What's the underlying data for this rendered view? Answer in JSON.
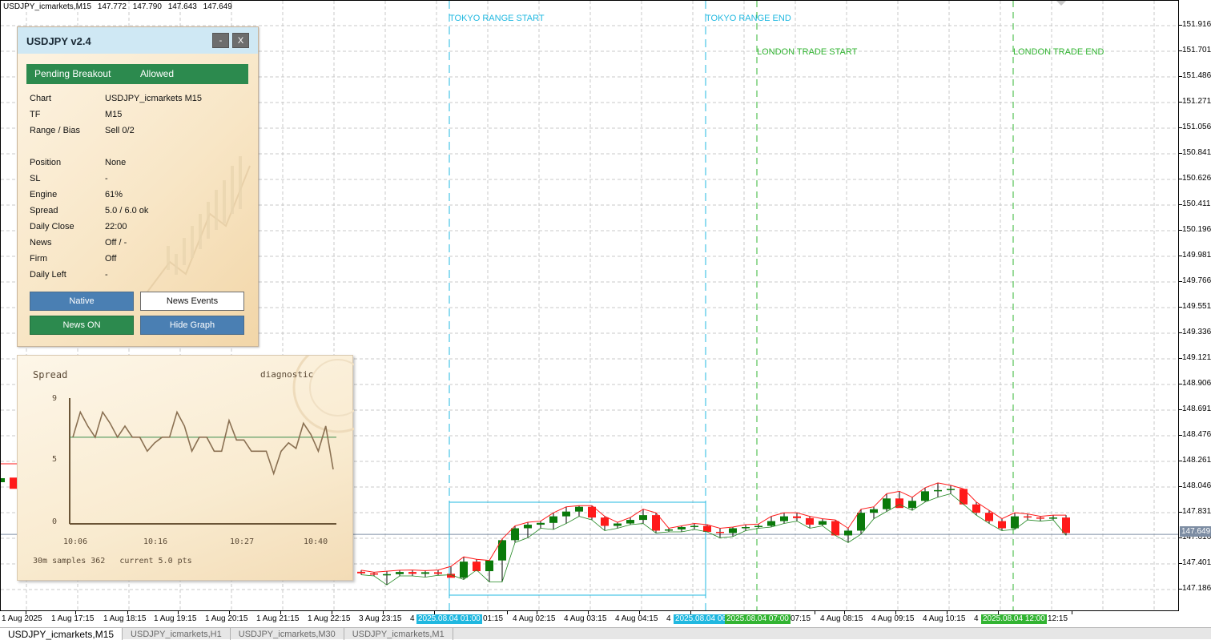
{
  "header": {
    "symbol_tf": "USDJPY_icmarkets,M15",
    "ohlc": [
      "147.772",
      "147.790",
      "147.643",
      "147.649"
    ]
  },
  "session_labels": {
    "tokyo_start": "TOKYO RANGE START",
    "tokyo_end": "TOKYO RANGE END",
    "london_start": "LONDON TRADE START",
    "london_end": "LONDON TRADE END"
  },
  "colors": {
    "tokyo": "#20b8e0",
    "london": "#32b432",
    "bull": "#0a7a0a",
    "bear": "#ff1a1a",
    "grid": "#c8c8c8",
    "current_price": "#7d8da3"
  },
  "price_axis": {
    "ticks": [
      "151.916",
      "151.701",
      "151.486",
      "151.271",
      "151.056",
      "150.841",
      "150.626",
      "150.411",
      "150.196",
      "149.981",
      "149.766",
      "149.551",
      "149.336",
      "149.121",
      "148.906",
      "148.691",
      "148.476",
      "148.261",
      "148.046",
      "147.831",
      "147.616",
      "147.401",
      "147.186"
    ],
    "current": "147.649"
  },
  "time_axis": {
    "ticks": [
      "1 Aug 2025",
      "1 Aug 17:15",
      "1 Aug 18:15",
      "1 Aug 19:15",
      "1 Aug 20:15",
      "1 Aug 21:15",
      "1 Aug 22:15",
      "3 Aug 23:15",
      "4",
      "01:15",
      "4 Aug 02:15",
      "4 Aug 03:15",
      "4 Aug 04:15",
      "4",
      "07:15",
      "4 Aug 08:15",
      "4 Aug 09:15",
      "4 Aug 10:15",
      "4",
      "12:15"
    ],
    "badges": [
      "2025.08.04 01:00",
      "2025.08.04 06:",
      "2025.08.04 07:00",
      "2025.08.04 12:00"
    ]
  },
  "tabs": [
    "USDJPY_icmarkets,M15",
    "USDJPY_icmarkets,H1",
    "USDJPY_icmarkets,M30",
    "USDJPY_icmarkets,M1"
  ],
  "panel": {
    "title": "USDJPY v2.4",
    "minimize": "-",
    "close": "X",
    "mode_label": "Pending Breakout",
    "mode_value": "Allowed",
    "rows": [
      {
        "label": "Chart",
        "value": "USDJPY_icmarkets M15"
      },
      {
        "label": "TF",
        "value": "M15"
      },
      {
        "label": "Range / Bias",
        "value": "Sell 0/2"
      },
      {
        "label": "Position",
        "value": "None"
      },
      {
        "label": "SL",
        "value": "-"
      },
      {
        "label": "Engine",
        "value": "61%"
      },
      {
        "label": "Spread",
        "value": "5.0 / 6.0 ok"
      },
      {
        "label": "Daily Close",
        "value": "22:00"
      },
      {
        "label": "News",
        "value": "Off / -"
      },
      {
        "label": "Firm",
        "value": "Off"
      },
      {
        "label": "Daily Left",
        "value": "-"
      }
    ],
    "buttons": {
      "native": "Native",
      "news_events": "News Events",
      "news_on": "News ON",
      "hide_graph": "Hide Graph"
    }
  },
  "spread_widget": {
    "title": "Spread",
    "tag": "diagnostic",
    "y_ticks": [
      "9",
      "5",
      "0"
    ],
    "x_ticks": [
      "10:06",
      "10:16",
      "10:27",
      "10:40"
    ],
    "footer": "30m samples 362   current 5.0 pts",
    "series": [
      6.2,
      8.0,
      7.0,
      6.2,
      8.0,
      7.2,
      6.2,
      7.0,
      6.2,
      6.2,
      5.2,
      5.8,
      6.2,
      6.2,
      8.0,
      7.0,
      5.2,
      6.2,
      6.2,
      5.2,
      5.2,
      7.4,
      6.0,
      6.0,
      5.2,
      5.2,
      5.2,
      3.6,
      5.2,
      5.8,
      5.4,
      7.2,
      6.4,
      5.2,
      7.0,
      3.9
    ],
    "avg": 6.2,
    "ymax": 9
  },
  "candles": [
    [
      147.335,
      147.348,
      147.31,
      147.322
    ],
    [
      147.322,
      147.331,
      147.3,
      147.311
    ],
    [
      147.311,
      147.34,
      147.225,
      147.315
    ],
    [
      147.315,
      147.348,
      147.3,
      147.333
    ],
    [
      147.333,
      147.35,
      147.3,
      147.318
    ],
    [
      147.318,
      147.345,
      147.29,
      147.331
    ],
    [
      147.331,
      147.35,
      147.305,
      147.318
    ],
    [
      147.318,
      147.38,
      147.31,
      147.285
    ],
    [
      147.285,
      147.46,
      147.27,
      147.42
    ],
    [
      147.42,
      147.44,
      147.35,
      147.34
    ],
    [
      147.34,
      147.43,
      147.25,
      147.43
    ],
    [
      147.43,
      147.61,
      147.25,
      147.6
    ],
    [
      147.6,
      147.72,
      147.58,
      147.7
    ],
    [
      147.7,
      147.75,
      147.62,
      147.73
    ],
    [
      147.73,
      147.76,
      147.7,
      147.745
    ],
    [
      147.745,
      147.83,
      147.69,
      147.8
    ],
    [
      147.8,
      147.88,
      147.74,
      147.84
    ],
    [
      147.84,
      147.89,
      147.8,
      147.88
    ],
    [
      147.88,
      147.89,
      147.77,
      147.79
    ],
    [
      147.79,
      147.8,
      147.68,
      147.72
    ],
    [
      147.72,
      147.75,
      147.7,
      147.74
    ],
    [
      147.74,
      147.79,
      147.73,
      147.77
    ],
    [
      147.77,
      147.86,
      147.74,
      147.81
    ],
    [
      147.81,
      147.83,
      147.66,
      147.68
    ],
    [
      147.68,
      147.7,
      147.67,
      147.69
    ],
    [
      147.69,
      147.72,
      147.67,
      147.71
    ],
    [
      147.71,
      147.74,
      147.69,
      147.72
    ],
    [
      147.72,
      147.73,
      147.67,
      147.67
    ],
    [
      147.67,
      147.7,
      147.62,
      147.66
    ],
    [
      147.66,
      147.71,
      147.63,
      147.7
    ],
    [
      147.7,
      147.73,
      147.68,
      147.71
    ],
    [
      147.71,
      147.735,
      147.7,
      147.72
    ],
    [
      147.72,
      147.8,
      147.71,
      147.76
    ],
    [
      147.76,
      147.83,
      147.74,
      147.8
    ],
    [
      147.8,
      147.83,
      147.76,
      147.785
    ],
    [
      147.785,
      147.8,
      147.7,
      147.73
    ],
    [
      147.73,
      147.78,
      147.72,
      147.76
    ],
    [
      147.76,
      147.77,
      147.64,
      147.64
    ],
    [
      147.64,
      147.7,
      147.58,
      147.68
    ],
    [
      147.68,
      147.86,
      147.65,
      147.83
    ],
    [
      147.83,
      147.88,
      147.78,
      147.86
    ],
    [
      147.86,
      147.99,
      147.84,
      147.95
    ],
    [
      147.95,
      148.01,
      147.9,
      147.87
    ],
    [
      147.87,
      147.96,
      147.85,
      147.93
    ],
    [
      147.93,
      148.04,
      147.92,
      148.01
    ],
    [
      148.01,
      148.08,
      147.96,
      148.02
    ],
    [
      148.02,
      148.06,
      147.99,
      148.03
    ],
    [
      148.03,
      148.03,
      147.9,
      147.9
    ],
    [
      147.9,
      147.92,
      147.81,
      147.83
    ],
    [
      147.83,
      147.85,
      147.74,
      147.76
    ],
    [
      147.76,
      147.78,
      147.68,
      147.7
    ],
    [
      147.7,
      147.83,
      147.69,
      147.8
    ],
    [
      147.8,
      147.82,
      147.77,
      147.79
    ],
    [
      147.79,
      147.8,
      147.76,
      147.78
    ],
    [
      147.78,
      147.81,
      147.77,
      147.79
    ],
    [
      147.79,
      147.81,
      147.64,
      147.66
    ]
  ]
}
